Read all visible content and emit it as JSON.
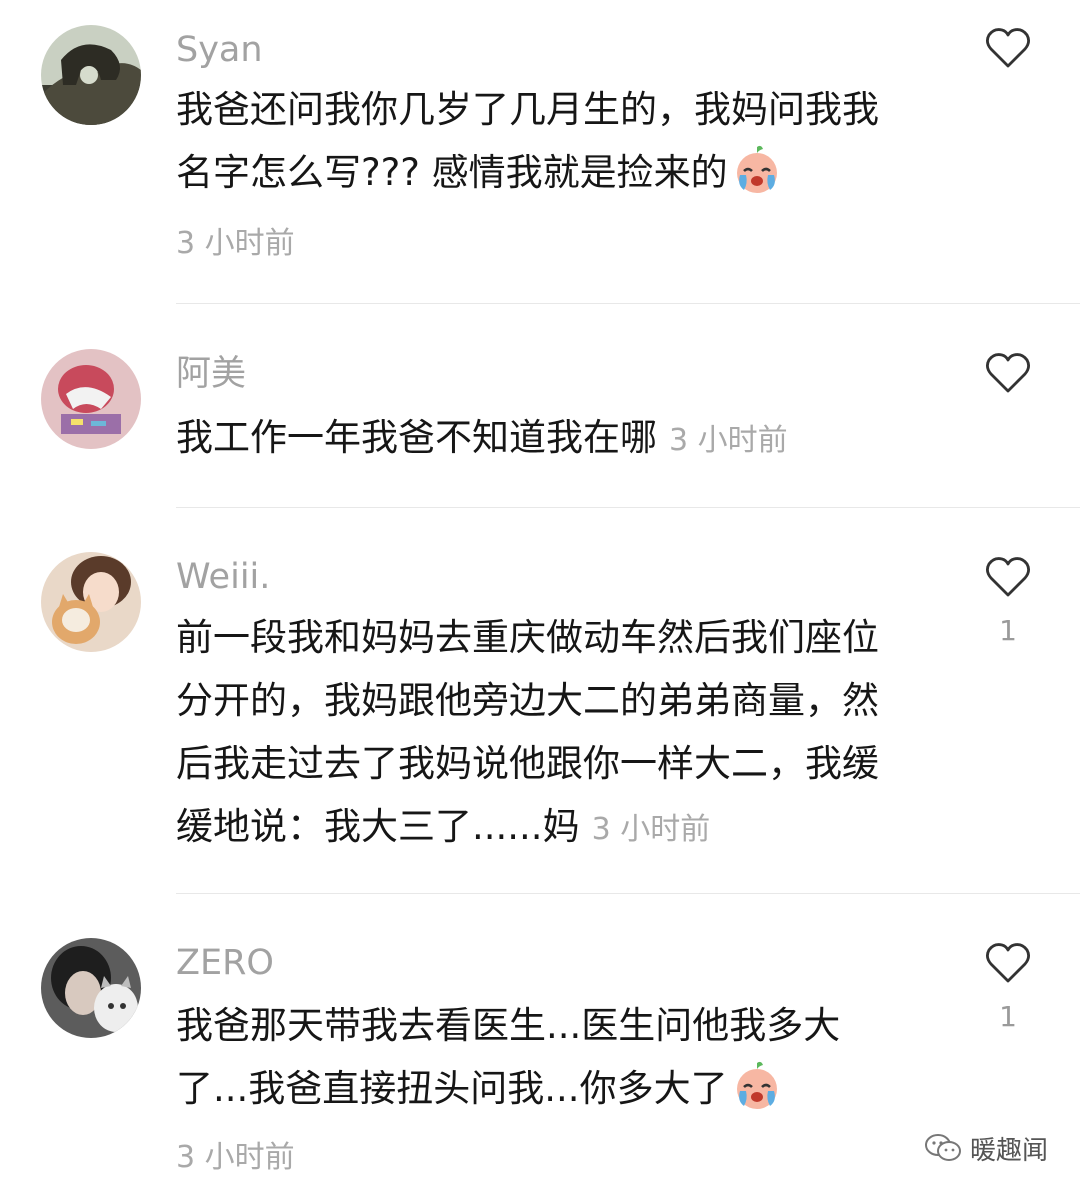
{
  "comments": [
    {
      "username": "Syan",
      "text_lines": [
        "我爸还问我你几岁了几月生的，我妈问我我",
        "名字怎么写??? 感情我就是捡来的"
      ],
      "emoji": "crying-face-emoji",
      "time": "3 小时前",
      "likes": null
    },
    {
      "username": "阿美",
      "text_lines": [
        "我工作一年我爸不知道我在哪"
      ],
      "time": "3 小时前",
      "likes": null
    },
    {
      "username": "Weiii.",
      "text_lines": [
        "前一段我和妈妈去重庆做动车然后我们座位",
        "分开的，我妈跟他旁边大二的弟弟商量，然",
        "后我走过去了我妈说他跟你一样大二，我缓",
        "缓地说：我大三了......妈"
      ],
      "time": "3 小时前",
      "likes": "1"
    },
    {
      "username": "ZERO",
      "text_lines": [
        "我爸那天带我去看医生...医生问他我多大",
        "了...我爸直接扭头问我...你多大了"
      ],
      "emoji": "crying-face-emoji",
      "time": "3 小时前",
      "likes": "1"
    }
  ],
  "icons": {
    "like": "heart-outline-icon",
    "watermark": "wechat-official-account-icon"
  },
  "watermark": {
    "text": "暖趣闻"
  },
  "colors": {
    "username": "#a2a2a2",
    "text": "#161616",
    "time": "#a9a9a9",
    "divider": "#e8e8e8"
  }
}
